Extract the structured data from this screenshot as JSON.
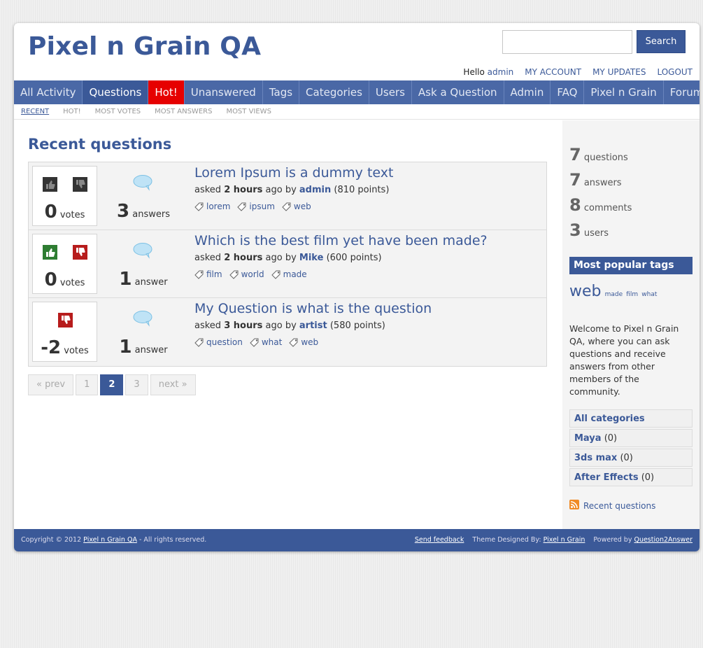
{
  "site": {
    "title": "Pixel n Grain QA"
  },
  "search": {
    "button": "Search",
    "placeholder": ""
  },
  "user_links": {
    "hello": "Hello",
    "user": "admin",
    "account": "MY ACCOUNT",
    "updates": "MY UPDATES",
    "logout": "LOGOUT"
  },
  "nav": [
    {
      "label": "All Activity"
    },
    {
      "label": "Questions"
    },
    {
      "label": "Hot!"
    },
    {
      "label": "Unanswered"
    },
    {
      "label": "Tags"
    },
    {
      "label": "Categories"
    },
    {
      "label": "Users"
    },
    {
      "label": "Ask a Question"
    },
    {
      "label": "Admin"
    },
    {
      "label": "FAQ"
    },
    {
      "label": "Pixel n Grain"
    },
    {
      "label": "Forums"
    }
  ],
  "subnav": [
    "RECENT",
    "HOT!",
    "MOST VOTES",
    "MOST ANSWERS",
    "MOST VIEWS"
  ],
  "page_title": "Recent questions",
  "questions": [
    {
      "votes": "0",
      "votes_label": "votes",
      "answers": "3",
      "answers_label": "answers",
      "title": "Lorem Ipsum is a dummy text",
      "asked": "asked",
      "when": "2 hours",
      "ago_by": "ago by",
      "author": "admin",
      "points": "(810 points)",
      "tags": [
        "lorem",
        "ipsum",
        "web"
      ]
    },
    {
      "votes": "0",
      "votes_label": "votes",
      "answers": "1",
      "answers_label": "answer",
      "title": "Which is the best film yet have been made?",
      "asked": "asked",
      "when": "2 hours",
      "ago_by": "ago by",
      "author": "Mike",
      "points": "(600 points)",
      "tags": [
        "film",
        "world",
        "made"
      ]
    },
    {
      "votes": "-2",
      "votes_label": "votes",
      "answers": "1",
      "answers_label": "answer",
      "title": "My Question is what is the question",
      "asked": "asked",
      "when": "3 hours",
      "ago_by": "ago by",
      "author": "artist",
      "points": "(580 points)",
      "tags": [
        "question",
        "what",
        "web"
      ]
    }
  ],
  "pager": {
    "prev": "« prev",
    "p1": "1",
    "p2": "2",
    "p3": "3",
    "next": "next »"
  },
  "stats": [
    {
      "num": "7",
      "label": "questions"
    },
    {
      "num": "7",
      "label": "answers"
    },
    {
      "num": "8",
      "label": "comments"
    },
    {
      "num": "3",
      "label": "users"
    }
  ],
  "sidebar": {
    "tags_heading": "Most popular tags",
    "tag_cloud": {
      "big": "web",
      "small": [
        "made",
        "film",
        "what"
      ]
    },
    "welcome": "Welcome to Pixel n Grain QA, where you can ask questions and receive answers from other members of the community.",
    "categories": [
      {
        "name": "All categories",
        "count": ""
      },
      {
        "name": "Maya",
        "count": "(0)"
      },
      {
        "name": "3ds max",
        "count": "(0)"
      },
      {
        "name": "After Effects",
        "count": "(0)"
      }
    ],
    "feed": "Recent questions"
  },
  "footer": {
    "copyright": "Copyright © 2012",
    "site_link": "Pixel n Grain QA",
    "rights": "- All rights reserved.",
    "feedback": "Send feedback",
    "theme_label": "Theme Designed By:",
    "theme_link": "Pixel n Grain",
    "powered_label": "Powered by",
    "powered_link": "Question2Answer"
  },
  "colors": {
    "brand": "#3b5998",
    "hot": "#e60000",
    "vote_up": "#2e7d32",
    "vote_down": "#b71c1c"
  }
}
